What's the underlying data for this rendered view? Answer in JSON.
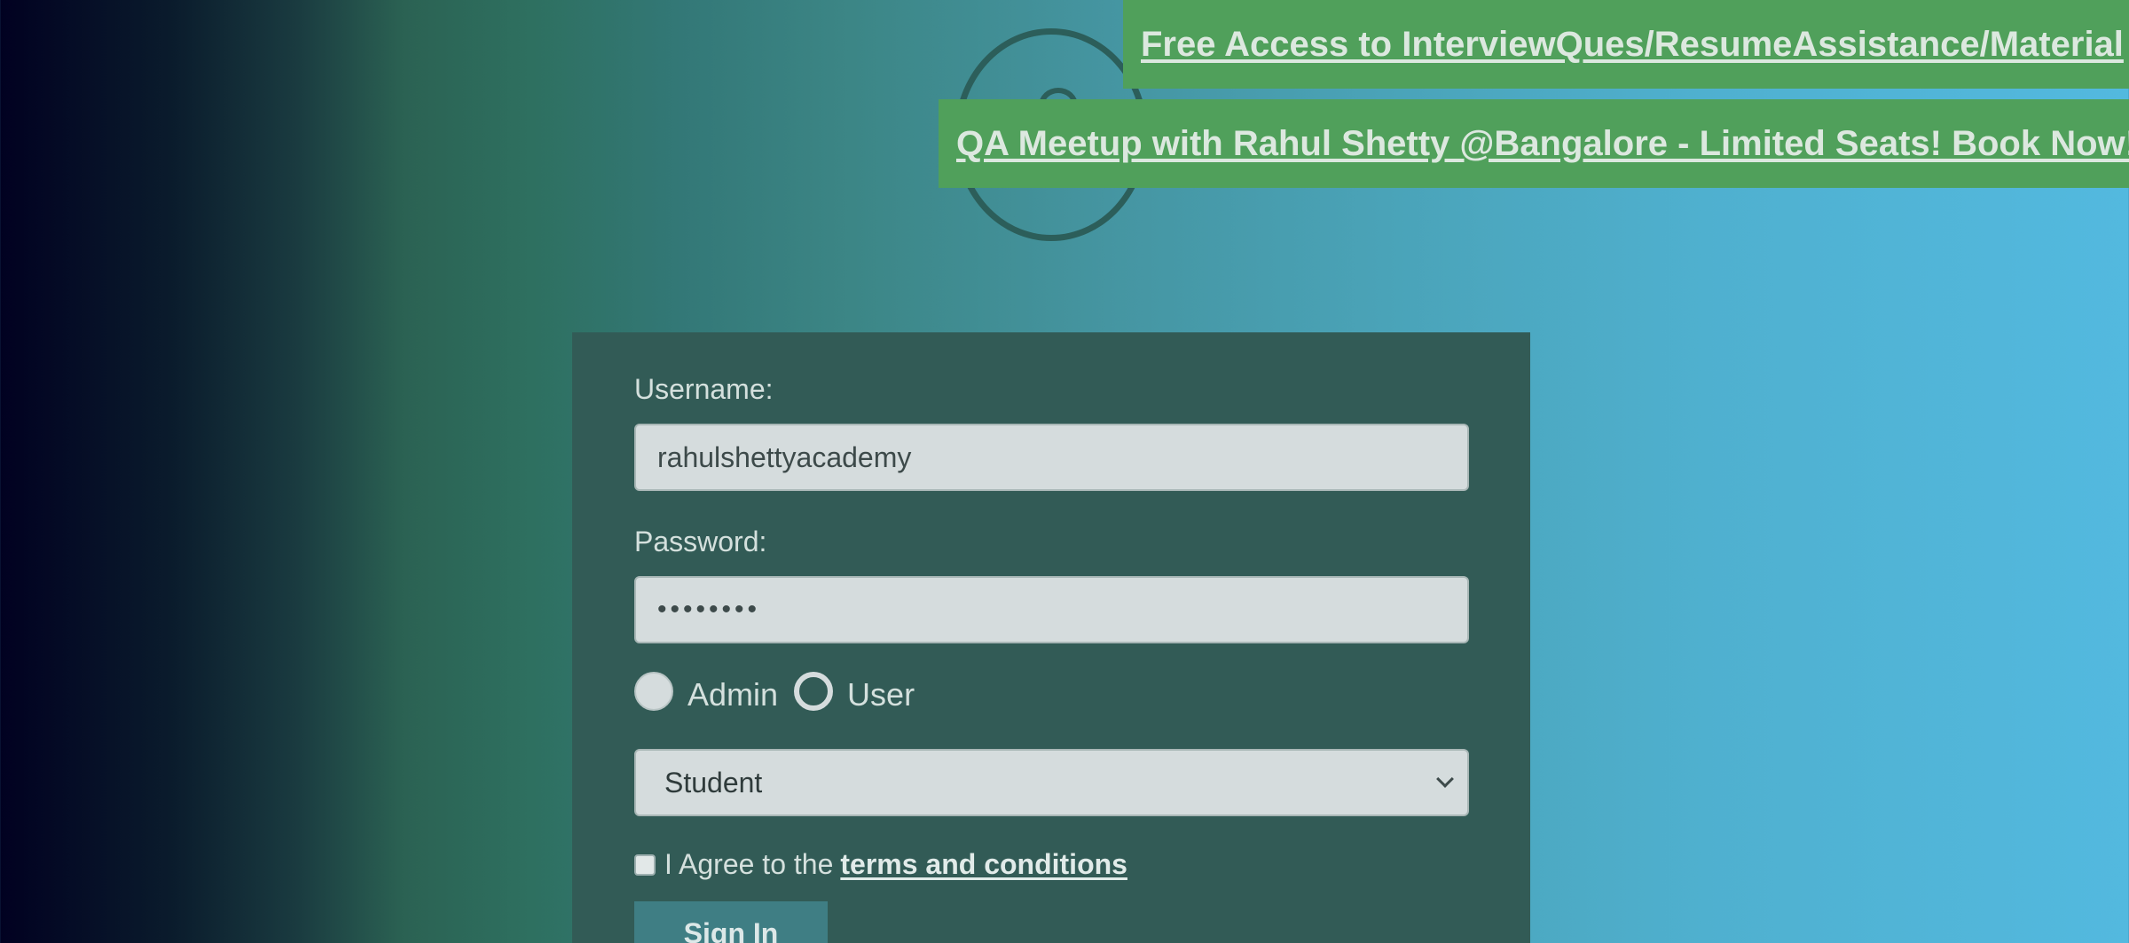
{
  "banners": {
    "free_access": "Free Access to InterviewQues/ResumeAssistance/Material",
    "meetup": "QA Meetup with Rahul Shetty @Bangalore - Limited Seats! Book Now!"
  },
  "login": {
    "username_label": "Username:",
    "username_value": "rahulshettyacademy",
    "password_label": "Password:",
    "password_value": "••••••••",
    "role_admin": "Admin",
    "role_user": "User",
    "role_selected": "User",
    "profile_selected": "Student",
    "terms_prefix": "I Agree to the",
    "terms_link": "terms and conditions",
    "terms_checked": false,
    "signin_label": "Sign In"
  },
  "icons": {
    "logo": "logo-icon",
    "dropdown": "chevron-down-icon"
  },
  "colors": {
    "banner_bg": "#50a05b",
    "panel_bg": "#325b56",
    "button_bg": "#3f7e84"
  }
}
